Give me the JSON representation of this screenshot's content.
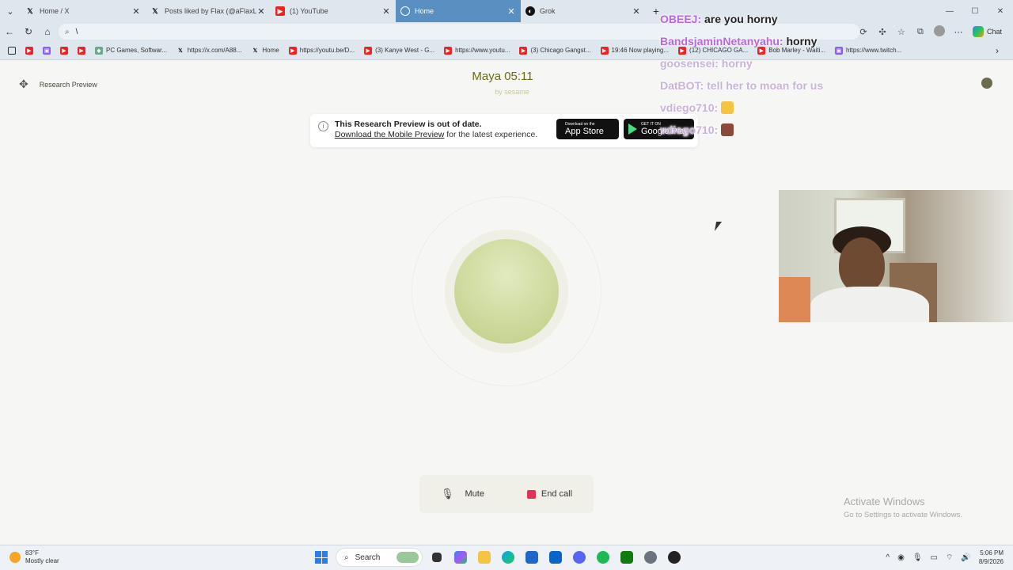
{
  "browser": {
    "tabs": [
      {
        "title": "Home / X",
        "icon": "x-logo-icon",
        "active": false
      },
      {
        "title": "Posts liked by Flax (@aFlaxLife) / X",
        "icon": "x-logo-icon",
        "active": false
      },
      {
        "title": "(1) YouTube",
        "icon": "youtube-icon",
        "active": false
      },
      {
        "title": "Home",
        "icon": "sesame-icon",
        "active": true
      },
      {
        "title": "Grok",
        "icon": "grok-icon",
        "active": false
      }
    ],
    "address": "\\",
    "chat_label": "Chat",
    "bookmarks": [
      {
        "label": "",
        "icon": "youtube-icon"
      },
      {
        "label": "",
        "icon": "twitch-icon"
      },
      {
        "label": "",
        "icon": "youtube-icon"
      },
      {
        "label": "",
        "icon": "youtube-icon"
      },
      {
        "label": "PC Games, Softwar...",
        "icon": "games-icon"
      },
      {
        "label": "https://x.com/A88...",
        "icon": "x-logo-icon"
      },
      {
        "label": "Home",
        "icon": "x-logo-icon"
      },
      {
        "label": "https://youtu.be/D...",
        "icon": "youtube-icon"
      },
      {
        "label": "(3) Kanye West - G...",
        "icon": "youtube-icon"
      },
      {
        "label": "https://www.youtu...",
        "icon": "youtube-icon"
      },
      {
        "label": "(3) Chicago Gangst...",
        "icon": "youtube-icon"
      },
      {
        "label": "19:46 Now playing...",
        "icon": "youtube-icon"
      },
      {
        "label": "(12) CHICAGO GA...",
        "icon": "youtube-icon"
      },
      {
        "label": "Bob Marley - Waiti...",
        "icon": "youtube-icon"
      },
      {
        "label": "https://www.twitch...",
        "icon": "twitch-icon"
      }
    ]
  },
  "page": {
    "research_preview": "Research Preview",
    "title": "Maya 05:11",
    "byline": "by sesame",
    "banner": {
      "heading": "This Research Preview is out of date.",
      "link": "Download the Mobile Preview",
      "rest": " for the latest experience.",
      "appstore_small": "Download on the",
      "appstore_big": "App Store",
      "gplay_small": "GET IT ON",
      "gplay_big": "Google Play"
    },
    "mute_label": "Mute",
    "end_label": "End call",
    "activate_title": "Activate Windows",
    "activate_sub": "Go to Settings to activate Windows."
  },
  "stream_chat": [
    {
      "user": "OBEEJ:",
      "message": "are you horny",
      "faint": false
    },
    {
      "user": "BandsjaminNetanyahu:",
      "message": "horny",
      "faint": false
    },
    {
      "user": "goosensei:",
      "message": "horny",
      "faint": true
    },
    {
      "user": "DatBOT:",
      "message": "tell her to moan for us",
      "faint": true
    },
    {
      "user": "vdiego710:",
      "message": "",
      "faint": false
    },
    {
      "user": "vdiego710:",
      "message": "",
      "faint": false
    }
  ],
  "taskbar": {
    "temperature": "83°F",
    "weather": "Mostly clear",
    "search_label": "Search",
    "time": "5:06 PM",
    "date": "8/9/2026"
  },
  "colors": {
    "accent_title": "#6a6a18",
    "orb": "#c9d696",
    "end_call": "#e0315a",
    "chat_user": "#b667e0"
  }
}
